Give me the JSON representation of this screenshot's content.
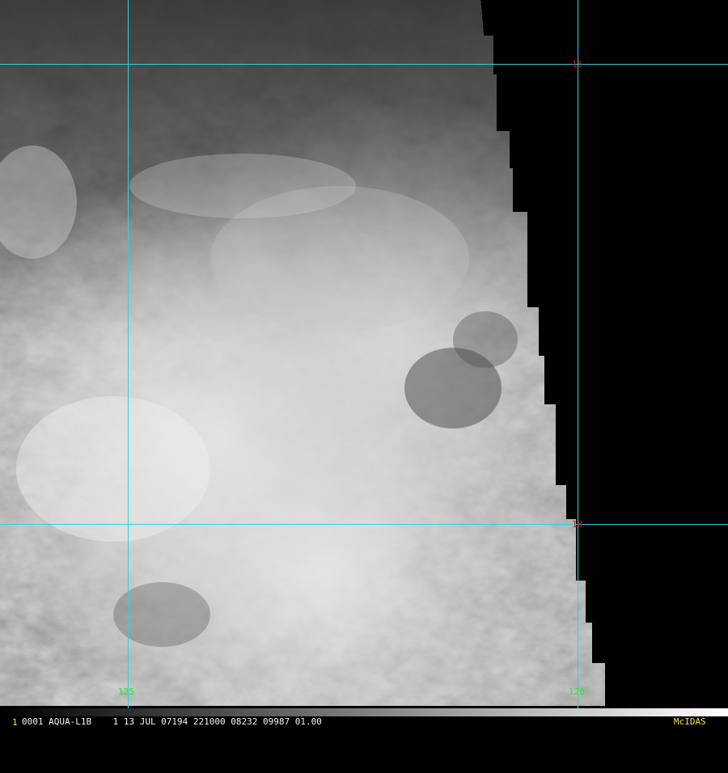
{
  "viewer": {
    "frame_number": "1",
    "header": "0001 AQUA-L1B    1 13 JUL 07194 221000 08232 09987 01.00",
    "brand": "McIDAS"
  },
  "colors": {
    "grid": "#2fd3dc",
    "lat_label": "#e01010",
    "lon_label": "#32e032",
    "frame_number": "#f4e44a",
    "header_text": "#f2f2f2",
    "brand": "#f4e44a",
    "no_data": "#000000"
  },
  "map": {
    "latitude_lines": [
      {
        "label": "15",
        "value": 15
      },
      {
        "label": "10",
        "value": 10
      }
    ],
    "longitude_lines": [
      {
        "label": "125",
        "value": 125
      },
      {
        "label": "120",
        "value": 120
      }
    ]
  }
}
